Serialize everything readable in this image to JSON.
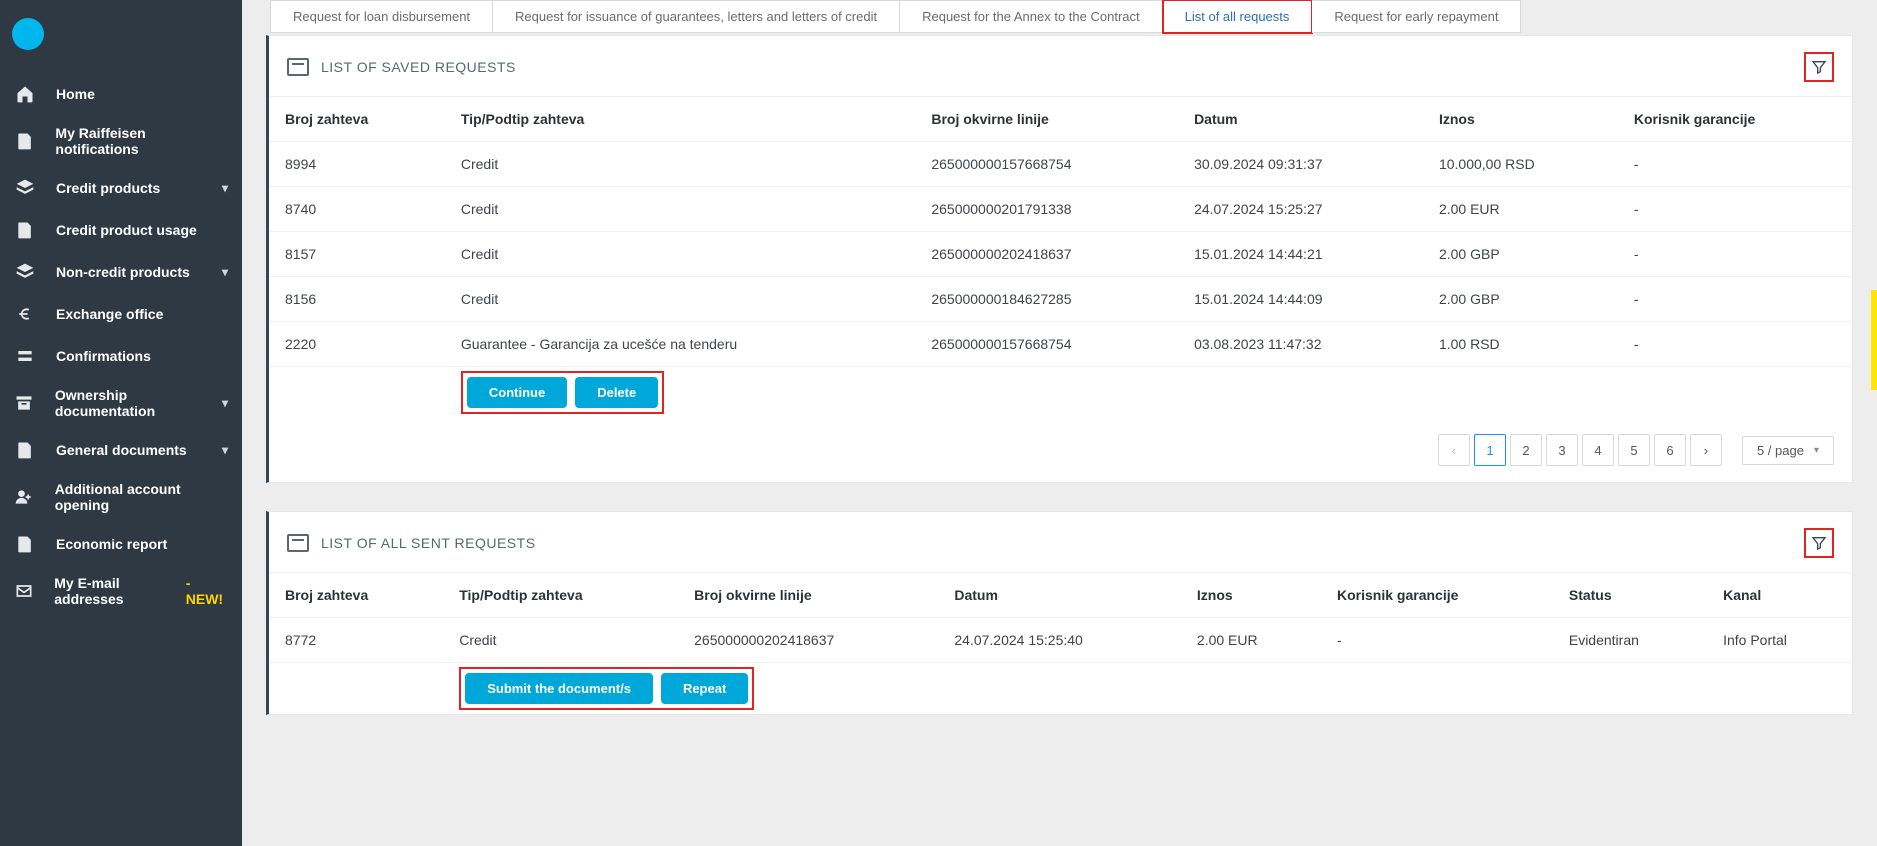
{
  "sidebar": {
    "items": [
      {
        "label": "Home",
        "icon": "home-icon",
        "expandable": false
      },
      {
        "label": "My Raiffeisen notifications",
        "icon": "doc-icon",
        "expandable": false
      },
      {
        "label": "Credit products",
        "icon": "layers-icon",
        "expandable": true
      },
      {
        "label": "Credit product usage",
        "icon": "doc-icon",
        "expandable": false
      },
      {
        "label": "Non-credit products",
        "icon": "layers-icon",
        "expandable": true
      },
      {
        "label": "Exchange office",
        "icon": "euro-icon",
        "expandable": false
      },
      {
        "label": "Confirmations",
        "icon": "currency-icon",
        "expandable": false
      },
      {
        "label": "Ownership documentation",
        "icon": "archive-icon",
        "expandable": true
      },
      {
        "label": "General documents",
        "icon": "doc-icon",
        "expandable": true
      },
      {
        "label": "Additional account opening",
        "icon": "user-plus-icon",
        "expandable": false
      },
      {
        "label": "Economic report",
        "icon": "doc-icon",
        "expandable": false
      },
      {
        "label": "My E-mail addresses",
        "icon": "mail-icon",
        "expandable": false,
        "badge": " - NEW!"
      }
    ]
  },
  "tabs": [
    {
      "label": "Request for loan disbursement",
      "active": false
    },
    {
      "label": "Request for issuance of guarantees, letters and letters of credit",
      "active": false
    },
    {
      "label": "Request for the Annex to the Contract",
      "active": false
    },
    {
      "label": "List of all requests",
      "active": true,
      "highlight": true
    },
    {
      "label": "Request for early repayment",
      "active": false
    }
  ],
  "cards": {
    "saved": {
      "title": "LIST OF SAVED REQUESTS",
      "columns": [
        "Broj zahteva",
        "Tip/Podtip zahteva",
        "Broj okvirne linije",
        "Datum",
        "Iznos",
        "Korisnik garancije"
      ],
      "rows": [
        {
          "c0": "8994",
          "c1": "Credit",
          "c2": "265000000157668754",
          "c3": "30.09.2024 09:31:37",
          "c4": "10.000,00 RSD",
          "c5": "-"
        },
        {
          "c0": "8740",
          "c1": "Credit",
          "c2": "265000000201791338",
          "c3": "24.07.2024 15:25:27",
          "c4": "2.00 EUR",
          "c5": "-"
        },
        {
          "c0": "8157",
          "c1": "Credit",
          "c2": "265000000202418637",
          "c3": "15.01.2024 14:44:21",
          "c4": "2.00 GBP",
          "c5": "-"
        },
        {
          "c0": "8156",
          "c1": "Credit",
          "c2": "265000000184627285",
          "c3": "15.01.2024 14:44:09",
          "c4": "2.00 GBP",
          "c5": "-"
        },
        {
          "c0": "2220",
          "c1": "Guarantee - Garancija za ucešće na tenderu",
          "c2": "265000000157668754",
          "c3": "03.08.2023 11:47:32",
          "c4": "1.00 RSD",
          "c5": "-"
        }
      ],
      "actions": {
        "continue": "Continue",
        "delete": "Delete"
      },
      "pager": {
        "prev": "‹",
        "pages": [
          "1",
          "2",
          "3",
          "4",
          "5",
          "6"
        ],
        "current": "1",
        "next": "›",
        "perpage": "5 / page"
      }
    },
    "sent": {
      "title": "LIST OF ALL SENT REQUESTS",
      "columns": [
        "Broj zahteva",
        "Tip/Podtip zahteva",
        "Broj okvirne linije",
        "Datum",
        "Iznos",
        "Korisnik garancije",
        "Status",
        "Kanal"
      ],
      "rows": [
        {
          "c0": "8772",
          "c1": "Credit",
          "c2": "265000000202418637",
          "c3": "24.07.2024 15:25:40",
          "c4": "2.00 EUR",
          "c5": "-",
          "c6": "Evidentiran",
          "c7": "Info Portal"
        }
      ],
      "actions": {
        "submit": "Submit the document/s",
        "repeat": "Repeat"
      }
    }
  }
}
